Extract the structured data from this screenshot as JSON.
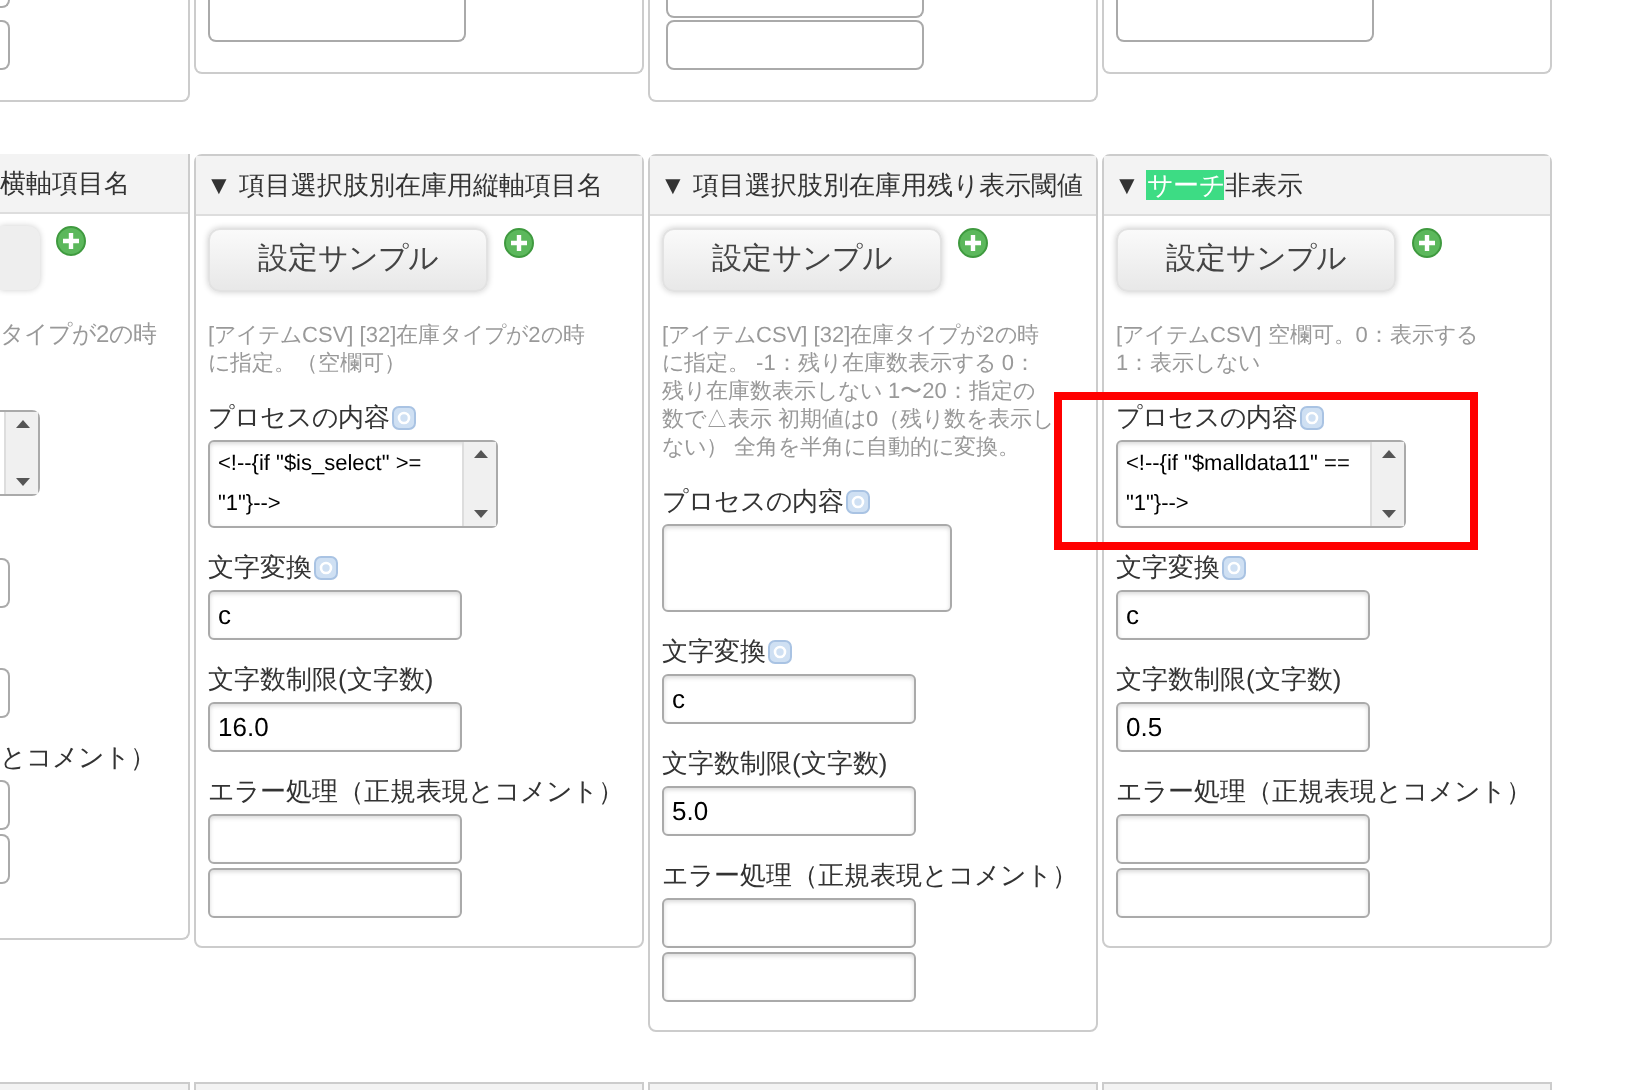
{
  "columns": [
    {
      "kind": "clipped",
      "title": "横軸項目名",
      "description": "タイプが2の時",
      "error_label": "とコメント）"
    },
    {
      "kind": "full",
      "title_parts": [
        {
          "text": "▼ 項目選択肢別在庫用縦軸項目名",
          "highlighted": false
        }
      ],
      "button": "設定サンプル",
      "description": "[アイテムCSV] [32]在庫タイプが2の時に指定。（空欄可）",
      "process_label": "プロセスの内容",
      "process_value": "<!--{if \"$is_select\" >= \"1\"}-->",
      "process_scrollbar": true,
      "conversion_label": "文字変換",
      "conversion_value": "c",
      "limit_label": "文字数制限(文字数)",
      "limit_value": "16.0",
      "error_label": "エラー処理（正規表現とコメント）"
    },
    {
      "kind": "full",
      "title_parts": [
        {
          "text": "▼ 項目選択肢別在庫用残り表示閾値",
          "highlighted": false
        }
      ],
      "button": "設定サンプル",
      "description": "[アイテムCSV] [32]在庫タイプが2の時に指定。 -1：残り在庫数表示する 0：残り在庫数表示しない 1〜20：指定の数で△表示 初期値は0（残り数を表示しない） 全角を半角に自動的に変換。",
      "process_label": "プロセスの内容",
      "process_scrollbar": false,
      "conversion_label": "文字変換",
      "conversion_value": "c",
      "limit_label": "文字数制限(文字数)",
      "limit_value": "5.0",
      "error_label": "エラー処理（正規表現とコメント）"
    },
    {
      "kind": "full",
      "title_parts": [
        {
          "text": "▼ ",
          "highlighted": false
        },
        {
          "text": "サーチ",
          "highlighted": true
        },
        {
          "text": "非表示",
          "highlighted": false
        }
      ],
      "button": "設定サンプル",
      "description": "[アイテムCSV] 空欄可。0：表示する 1：表示しない",
      "process_label": "プロセスの内容",
      "process_value": "<!--{if \"$malldata11\" == \"1\"}-->",
      "process_scrollbar": true,
      "conversion_label": "文字変換",
      "conversion_value": "c",
      "limit_label": "文字数制限(文字数)",
      "limit_value": "0.5",
      "error_label": "エラー処理（正規表現とコメント）"
    }
  ]
}
